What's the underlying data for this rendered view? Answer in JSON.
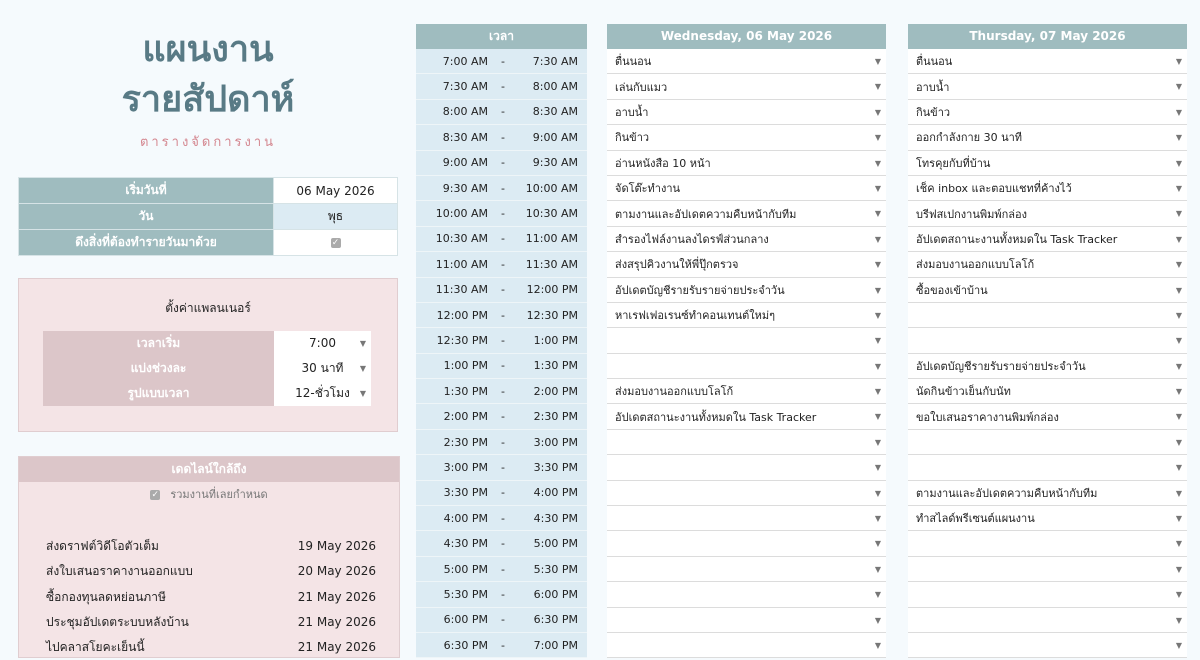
{
  "title_line1": "แผนงาน",
  "title_line2": "รายสัปดาห์",
  "subtitle": "ตารางจัดการงาน",
  "info": {
    "start_label": "เริ่มวันที่",
    "start_value": "06 May 2026",
    "day_label": "วัน",
    "day_value": "พุธ",
    "carry_label": "ดึงสิ่งที่ต้องทำรายวันมาด้วย",
    "carry_checked": true
  },
  "settings": {
    "title": "ตั้งค่าแพลนเนอร์",
    "rows": [
      {
        "label": "เวลาเริ่ม",
        "value": "7:00"
      },
      {
        "label": "แบ่งช่วงละ",
        "value": "30 นาที"
      },
      {
        "label": "รูปแบบเวลา",
        "value": "12-ชั่วโมง"
      }
    ]
  },
  "deadlines": {
    "title": "เดดไลน์ใกล้ถึง",
    "include_overdue_label": "รวมงานที่เลยกำหนด",
    "include_overdue_checked": true,
    "items": [
      {
        "task": "ส่งดราฟต์วิดีโอตัวเต็ม",
        "date": "19 May 2026"
      },
      {
        "task": "ส่งใบเสนอราคางานออกแบบ",
        "date": "20 May 2026"
      },
      {
        "task": "ซื้อกองทุนลดหย่อนภาษี",
        "date": "21 May 2026"
      },
      {
        "task": "ประชุมอัปเดตระบบหลังบ้าน",
        "date": "21 May 2026"
      },
      {
        "task": "ไปคลาสโยคะเย็นนี้",
        "date": "21 May 2026"
      }
    ]
  },
  "time_header": "เวลา",
  "time_slots": [
    {
      "start": "7:00 AM",
      "end": "7:30 AM"
    },
    {
      "start": "7:30 AM",
      "end": "8:00 AM"
    },
    {
      "start": "8:00 AM",
      "end": "8:30 AM"
    },
    {
      "start": "8:30 AM",
      "end": "9:00 AM"
    },
    {
      "start": "9:00 AM",
      "end": "9:30 AM"
    },
    {
      "start": "9:30 AM",
      "end": "10:00 AM"
    },
    {
      "start": "10:00 AM",
      "end": "10:30 AM"
    },
    {
      "start": "10:30 AM",
      "end": "11:00 AM"
    },
    {
      "start": "11:00 AM",
      "end": "11:30 AM"
    },
    {
      "start": "11:30 AM",
      "end": "12:00 PM"
    },
    {
      "start": "12:00 PM",
      "end": "12:30 PM"
    },
    {
      "start": "12:30 PM",
      "end": "1:00 PM"
    },
    {
      "start": "1:00 PM",
      "end": "1:30 PM"
    },
    {
      "start": "1:30 PM",
      "end": "2:00 PM"
    },
    {
      "start": "2:00 PM",
      "end": "2:30 PM"
    },
    {
      "start": "2:30 PM",
      "end": "3:00 PM"
    },
    {
      "start": "3:00 PM",
      "end": "3:30 PM"
    },
    {
      "start": "3:30 PM",
      "end": "4:00 PM"
    },
    {
      "start": "4:00 PM",
      "end": "4:30 PM"
    },
    {
      "start": "4:30 PM",
      "end": "5:00 PM"
    },
    {
      "start": "5:00 PM",
      "end": "5:30 PM"
    },
    {
      "start": "5:30 PM",
      "end": "6:00 PM"
    },
    {
      "start": "6:00 PM",
      "end": "6:30 PM"
    },
    {
      "start": "6:30 PM",
      "end": "7:00 PM"
    }
  ],
  "days": [
    {
      "header": "Wednesday, 06 May 2026",
      "tasks": [
        "ตื่นนอน",
        "เล่นกับแมว",
        "อาบน้ำ",
        "กินข้าว",
        "อ่านหนังสือ 10 หน้า",
        "จัดโต๊ะทำงาน",
        "ตามงานและอัปเดตความคืบหน้ากับทีม",
        "สำรองไฟล์งานลงไดรฟ์ส่วนกลาง",
        "ส่งสรุปคิวงานให้พี่ปุ๊กตรวจ",
        "อัปเดตบัญชีรายรับรายจ่ายประจำวัน",
        "หาเรฟเฟอเรนซ์ทำคอนเทนต์ใหม่ๆ",
        "",
        "",
        "ส่งมอบงานออกแบบโลโก้",
        "อัปเดตสถานะงานทั้งหมดใน Task Tracker",
        "",
        "",
        "",
        "",
        "",
        "",
        "",
        "",
        ""
      ]
    },
    {
      "header": "Thursday, 07 May 2026",
      "tasks": [
        "ตื่นนอน",
        "อาบน้ำ",
        "กินข้าว",
        "ออกกำลังกาย 30 นาที",
        "โทรคุยกับที่บ้าน",
        "เช็ค inbox และตอบแชทที่ค้างไว้",
        "บรีฟสเปกงานพิมพ์กล่อง",
        "อัปเดตสถานะงานทั้งหมดใน Task Tracker",
        "ส่งมอบงานออกแบบโลโก้",
        "ซื้อของเข้าบ้าน",
        "",
        "",
        "อัปเดตบัญชีรายรับรายจ่ายประจำวัน",
        "นัดกินข้าวเย็นกับนัท",
        "ขอใบเสนอราคางานพิมพ์กล่อง",
        "",
        "",
        "ตามงานและอัปเดตความคืบหน้ากับทีม",
        "ทำสไลด์พรีเซนต์แผนงาน",
        "",
        "",
        "",
        "",
        ""
      ]
    }
  ],
  "colors": {
    "teal_header": "#9fbcbf",
    "title_teal": "#587a85",
    "pink_panel": "#f4e4e6",
    "pink_header": "#dcc6c9",
    "light_blue": "#dcebf3",
    "subtitle_pink": "#d48790"
  }
}
